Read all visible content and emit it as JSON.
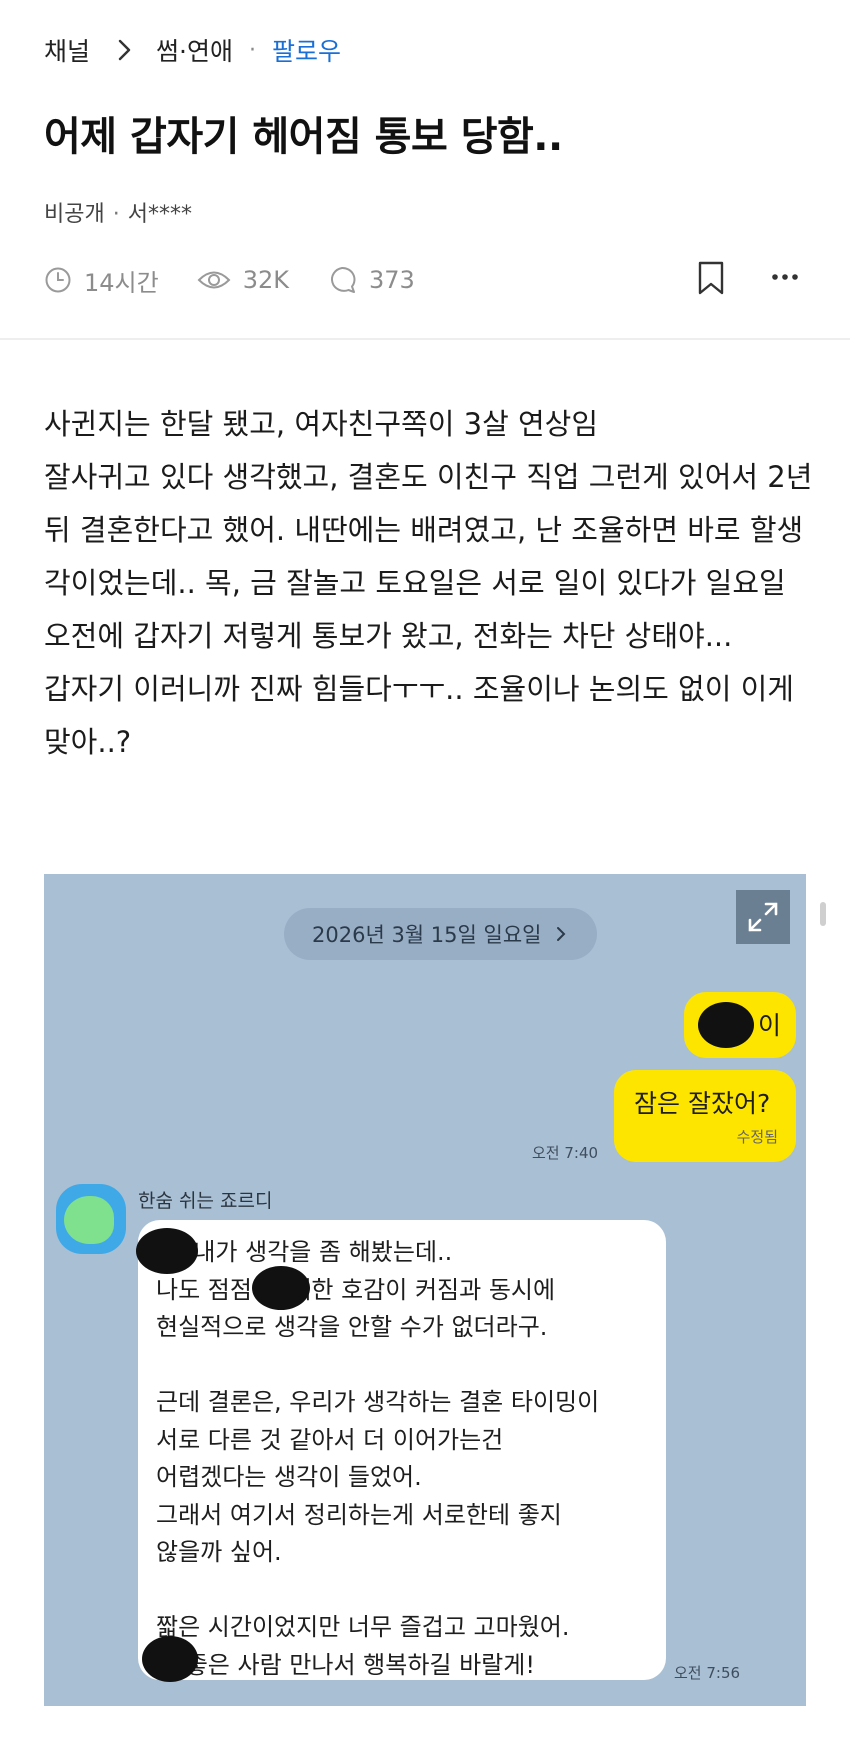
{
  "breadcrumb": {
    "channel": "채널",
    "category": "썸·연애",
    "dot": "·",
    "follow": "팔로우"
  },
  "post": {
    "title": "어제 갑자기 헤어짐 통보 당함..",
    "visibility": "비공개",
    "separator": "·",
    "author": "서****"
  },
  "meta": {
    "time": "14시간",
    "views": "32K",
    "comments": "373"
  },
  "body": {
    "paragraph1": "사귄지는 한달 됐고, 여자친구쪽이 3살 연상임\n잘사귀고 있다 생각했고, 결혼도 이친구 직업 그런게 있어서 2년뒤 결혼한다고 했어. 내딴에는 배려였고, 난 조율하면 바로 할생각이었는데.. 목, 금 잘놀고 토요일은 서로 일이 있다가 일요일 오전에 갑자기 저렇게 통보가 왔고, 전화는 차단 상태야...",
    "paragraph2": "갑자기 이러니까 진짜 힘들다ㅜㅜ.. 조율이나 논의도 없이 이게 맞아..?"
  },
  "chat": {
    "date": "2026년 3월 15일 일요일",
    "my_msg1_suffix": "이",
    "my_msg2": "잠은 잘잤어?",
    "edited_label": "수정됨",
    "time1": "오전 7:40",
    "sender": "한숨 쉬는 죠르디",
    "reply": "야, 내가 생각을 좀 해봤는데..\n나도 점점        에 대한 호감이 커짐과 동시에\n현실적으로 생각을 안할 수가 없더라구.\n\n근데 결론은, 우리가 생각하는 결혼 타이밍이\n서로 다른 것 같아서 더 이어가는건\n어렵겠다는 생각이 들었어.\n그래서 여기서 정리하는게 서로한테 좋지\n않을까 싶어.\n\n짧은 시간이었지만 너무 즐겁고 고마웠어.\n      도 좋은 사람 만나서 행복하길 바랄게!",
    "time2": "오전 7:56",
    "colors": {
      "background": "#a9bfd4",
      "my_bubble": "#fee500",
      "their_bubble": "#ffffff"
    }
  },
  "icons": [
    "chevron-right-icon",
    "clock-icon",
    "eye-icon",
    "comment-icon",
    "bookmark-icon",
    "more-icon",
    "expand-icon"
  ],
  "accent_color": "#1a6fd6"
}
